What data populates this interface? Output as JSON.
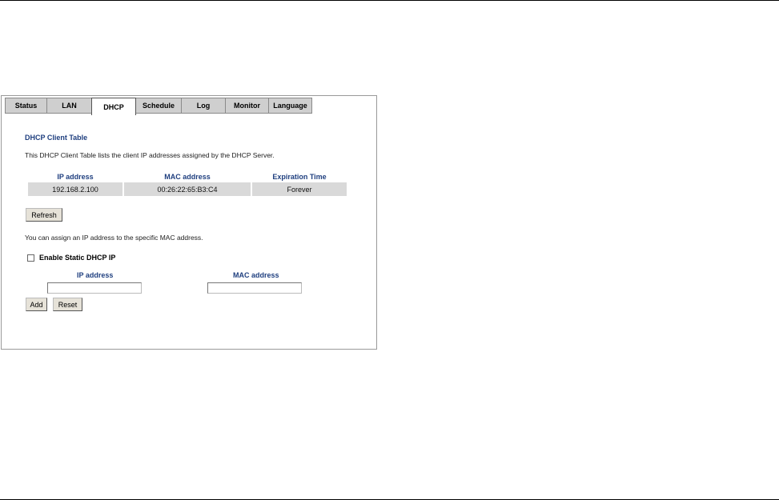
{
  "tabs": [
    {
      "label": "Status",
      "active": false
    },
    {
      "label": "LAN",
      "active": false
    },
    {
      "label": "DHCP",
      "active": true
    },
    {
      "label": "Schedule",
      "active": false
    },
    {
      "label": "Log",
      "active": false
    },
    {
      "label": "Monitor",
      "active": false
    },
    {
      "label": "Language",
      "active": false
    }
  ],
  "client_table": {
    "title": "DHCP Client Table",
    "description": "This DHCP Client Table lists the client IP addresses assigned by the DHCP Server.",
    "headers": [
      "IP address",
      "MAC address",
      "Expiration Time"
    ],
    "rows": [
      [
        "192.168.2.100",
        "00:26:22:65:B3:C4",
        "Forever"
      ]
    ],
    "refresh_label": "Refresh"
  },
  "static_dhcp": {
    "assign_text": "You can assign an IP address to the specific MAC address.",
    "enable_label": "Enable Static DHCP IP",
    "enabled": false,
    "ip_label": "IP address",
    "mac_label": "MAC address",
    "ip_value": "",
    "mac_value": "",
    "add_label": "Add",
    "reset_label": "Reset"
  },
  "colors": {
    "heading_blue": "#1f3f7f",
    "cell_gray": "#d9d9d9",
    "tab_gray": "#cfcfcf"
  }
}
